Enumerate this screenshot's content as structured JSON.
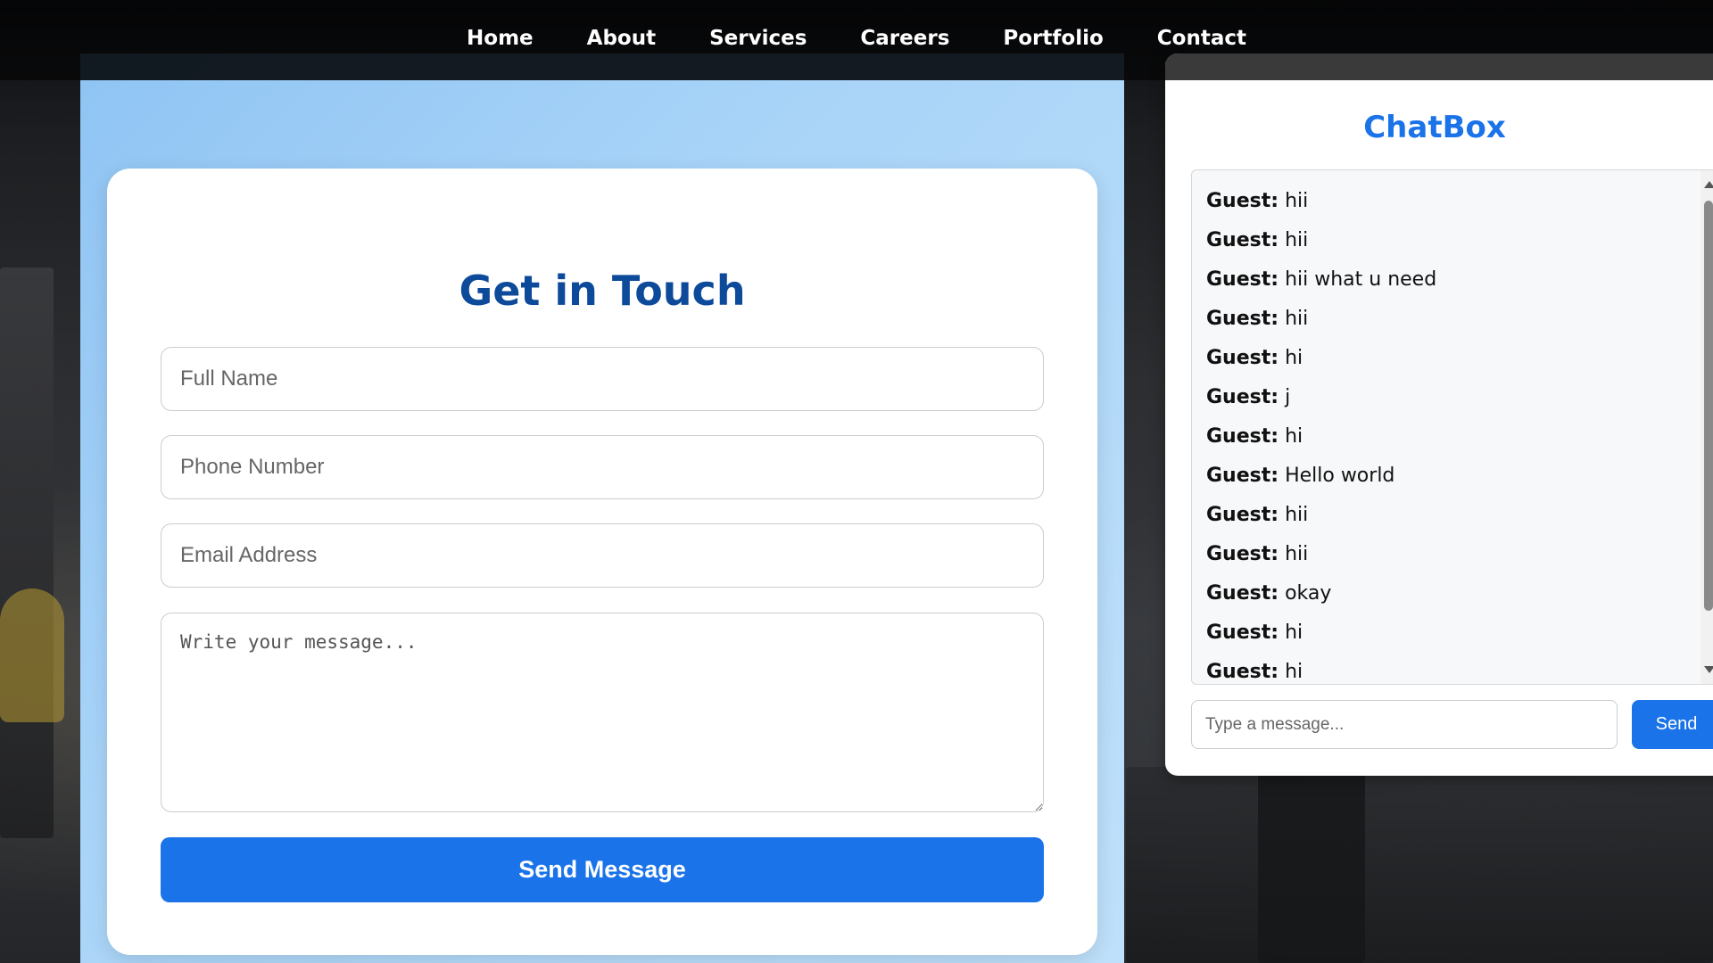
{
  "nav": {
    "items": [
      "Home",
      "About",
      "Services",
      "Careers",
      "Portfolio",
      "Contact"
    ]
  },
  "contact_form": {
    "title": "Get in Touch",
    "full_name_placeholder": "Full Name",
    "phone_placeholder": "Phone Number",
    "email_placeholder": "Email Address",
    "message_placeholder": "Write your message...",
    "submit_label": "Send Message"
  },
  "chat": {
    "title": "ChatBox",
    "messages": [
      {
        "sender": "Guest:",
        "text": "hii"
      },
      {
        "sender": "Guest:",
        "text": "hii"
      },
      {
        "sender": "Guest:",
        "text": "hii what u need"
      },
      {
        "sender": "Guest:",
        "text": "hii"
      },
      {
        "sender": "Guest:",
        "text": "hi"
      },
      {
        "sender": "Guest:",
        "text": "j"
      },
      {
        "sender": "Guest:",
        "text": "hi"
      },
      {
        "sender": "Guest:",
        "text": "Hello world"
      },
      {
        "sender": "Guest:",
        "text": "hii"
      },
      {
        "sender": "Guest:",
        "text": "hii"
      },
      {
        "sender": "Guest:",
        "text": "okay"
      },
      {
        "sender": "Guest:",
        "text": "hi"
      },
      {
        "sender": "Guest:",
        "text": "hi"
      }
    ],
    "input_placeholder": "Type a message...",
    "send_label": "Send"
  }
}
